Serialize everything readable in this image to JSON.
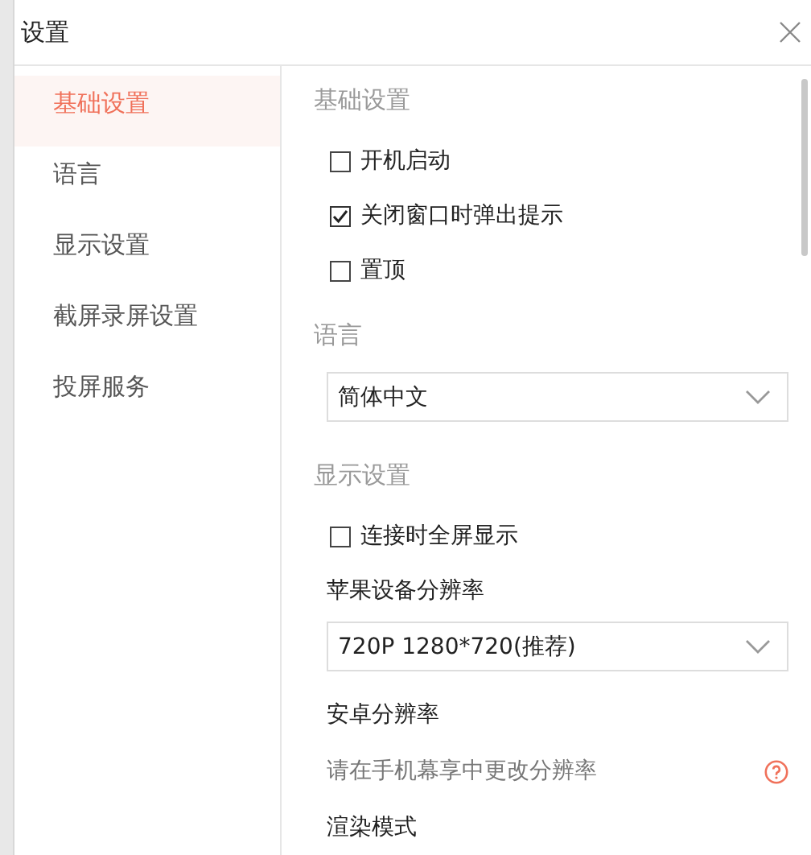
{
  "window": {
    "title": "设置"
  },
  "sidebar": {
    "items": [
      {
        "label": "基础设置",
        "selected": true
      },
      {
        "label": "语言",
        "selected": false
      },
      {
        "label": "显示设置",
        "selected": false
      },
      {
        "label": "截屏录屏设置",
        "selected": false
      },
      {
        "label": "投屏服务",
        "selected": false
      }
    ]
  },
  "sections": [
    {
      "heading": "基础设置",
      "items": [
        {
          "kind": "checkbox",
          "label": "开机启动",
          "checked": false
        },
        {
          "kind": "checkbox",
          "label": "关闭窗口时弹出提示",
          "checked": true
        },
        {
          "kind": "checkbox",
          "label": "置顶",
          "checked": false
        }
      ]
    },
    {
      "heading": "语言",
      "items": [
        {
          "kind": "select",
          "value": "简体中文"
        }
      ]
    },
    {
      "heading": "显示设置",
      "items": [
        {
          "kind": "checkbox",
          "label": "连接时全屏显示",
          "checked": false
        },
        {
          "kind": "label",
          "label": "苹果设备分辨率"
        },
        {
          "kind": "select",
          "value": "720P 1280*720(推荐)"
        },
        {
          "kind": "label",
          "label": "安卓分辨率"
        },
        {
          "kind": "hint",
          "label": "请在手机幕享中更改分辨率"
        },
        {
          "kind": "label",
          "label": "渲染模式"
        }
      ]
    }
  ]
}
